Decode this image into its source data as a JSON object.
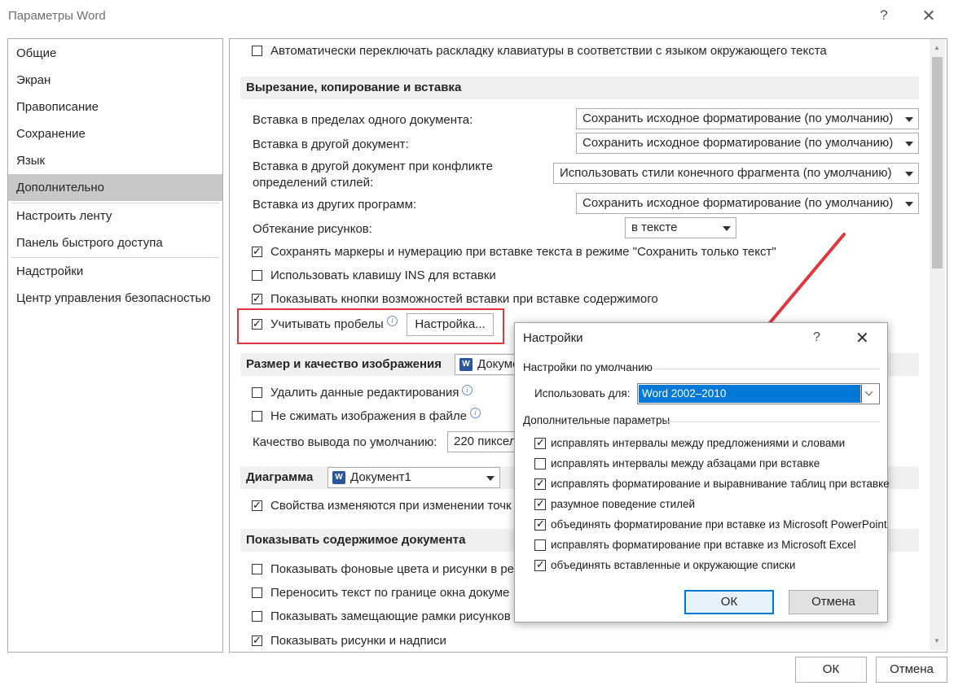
{
  "window": {
    "title": "Параметры Word",
    "help": "?",
    "close": "✕"
  },
  "nav": {
    "items": [
      {
        "label": "Общие"
      },
      {
        "label": "Экран"
      },
      {
        "label": "Правописание"
      },
      {
        "label": "Сохранение"
      },
      {
        "label": "Язык"
      },
      {
        "label": "Дополнительно",
        "selected": true
      },
      {
        "label": "Настроить ленту"
      },
      {
        "label": "Панель быстрого доступа"
      },
      {
        "label": "Надстройки"
      },
      {
        "label": "Центр управления безопасностью"
      }
    ]
  },
  "main": {
    "auto_switch": {
      "label": "Автоматически переключать раскладку клавиатуры в соответствии с языком окружающего текста",
      "checked": false
    },
    "cut_section": "Вырезание, копирование и вставка",
    "paste_within": {
      "label": "Вставка в пределах одного документа:",
      "value": "Сохранить исходное форматирование (по умолчанию)"
    },
    "paste_other": {
      "label": "Вставка в другой документ:",
      "value": "Сохранить исходное форматирование (по умолчанию)"
    },
    "paste_conflict": {
      "label_line1": "Вставка в другой документ при конфликте",
      "label_line2": "определений стилей:",
      "value": "Использовать стили конечного фрагмента (по умолчанию)"
    },
    "paste_programs": {
      "label": "Вставка из других программ:",
      "value": "Сохранить исходное форматирование (по умолчанию)"
    },
    "wrap": {
      "label": "Обтекание рисунков:",
      "value": "в тексте"
    },
    "keep_bullets": {
      "label": "Сохранять маркеры и нумерацию при вставке текста в режиме \"Сохранить только текст\"",
      "checked": true
    },
    "use_ins": {
      "label": "Использовать клавишу INS для вставки",
      "checked": false
    },
    "show_paste_buttons": {
      "label": "Показывать кнопки возможностей вставки при вставке содержимого",
      "checked": true
    },
    "smart_spacing": {
      "label": "Учитывать пробелы",
      "checked": true,
      "button": "Настройка..."
    },
    "image_section": "Размер и качество изображения",
    "image_doc": "Документ1",
    "discard_edit": {
      "label": "Удалить данные редактирования",
      "checked": false
    },
    "no_compress": {
      "label": "Не сжимать изображения в файле",
      "checked": false
    },
    "default_quality": {
      "label": "Качество вывода по умолчанию:",
      "value": "220 пиксел"
    },
    "chart_section": "Диаграмма",
    "chart_doc": "Документ1",
    "chart_props": {
      "label": "Свойства изменяются при изменении точк",
      "checked": true
    },
    "show_section": "Показывать содержимое документа",
    "show_bg": {
      "label": "Показывать фоновые цвета и рисунки в ре",
      "checked": false
    },
    "wrap_window": {
      "label": "Переносить текст по границе окна докуме",
      "checked": false
    },
    "placeholders": {
      "label": "Показывать замещающие рамки рисунков",
      "checked": false
    },
    "show_drawings": {
      "label": "Показывать рисунки и надписи",
      "checked": true
    }
  },
  "footer": {
    "ok": "ОК",
    "cancel": "Отмена"
  },
  "dialog": {
    "title": "Настройки",
    "help": "?",
    "close": "✕",
    "defaults_group": "Настройки по умолчанию",
    "use_for_label": "Использовать для:",
    "use_for_value": "Word 2002–2010",
    "extra_group": "Дополнительные параметры",
    "options": [
      {
        "label": "исправлять интервалы между предложениями и словами",
        "checked": true
      },
      {
        "label": "исправлять интервалы между абзацами при вставке",
        "checked": false
      },
      {
        "label": "исправлять форматирование и выравнивание таблиц при вставке",
        "checked": true
      },
      {
        "label": "разумное поведение стилей",
        "checked": true
      },
      {
        "label": "объединять форматирование при вставке из Microsoft PowerPoint",
        "checked": true
      },
      {
        "label": "исправлять форматирование при вставке из Microsoft Excel",
        "checked": false
      },
      {
        "label": "объединять вставленные и окружающие списки",
        "checked": true
      }
    ],
    "ok": "ОК",
    "cancel": "Отмена"
  },
  "colors": {
    "highlight_box": "#e0363d",
    "arrow": "#e0363d",
    "selection": "#0078d7"
  }
}
